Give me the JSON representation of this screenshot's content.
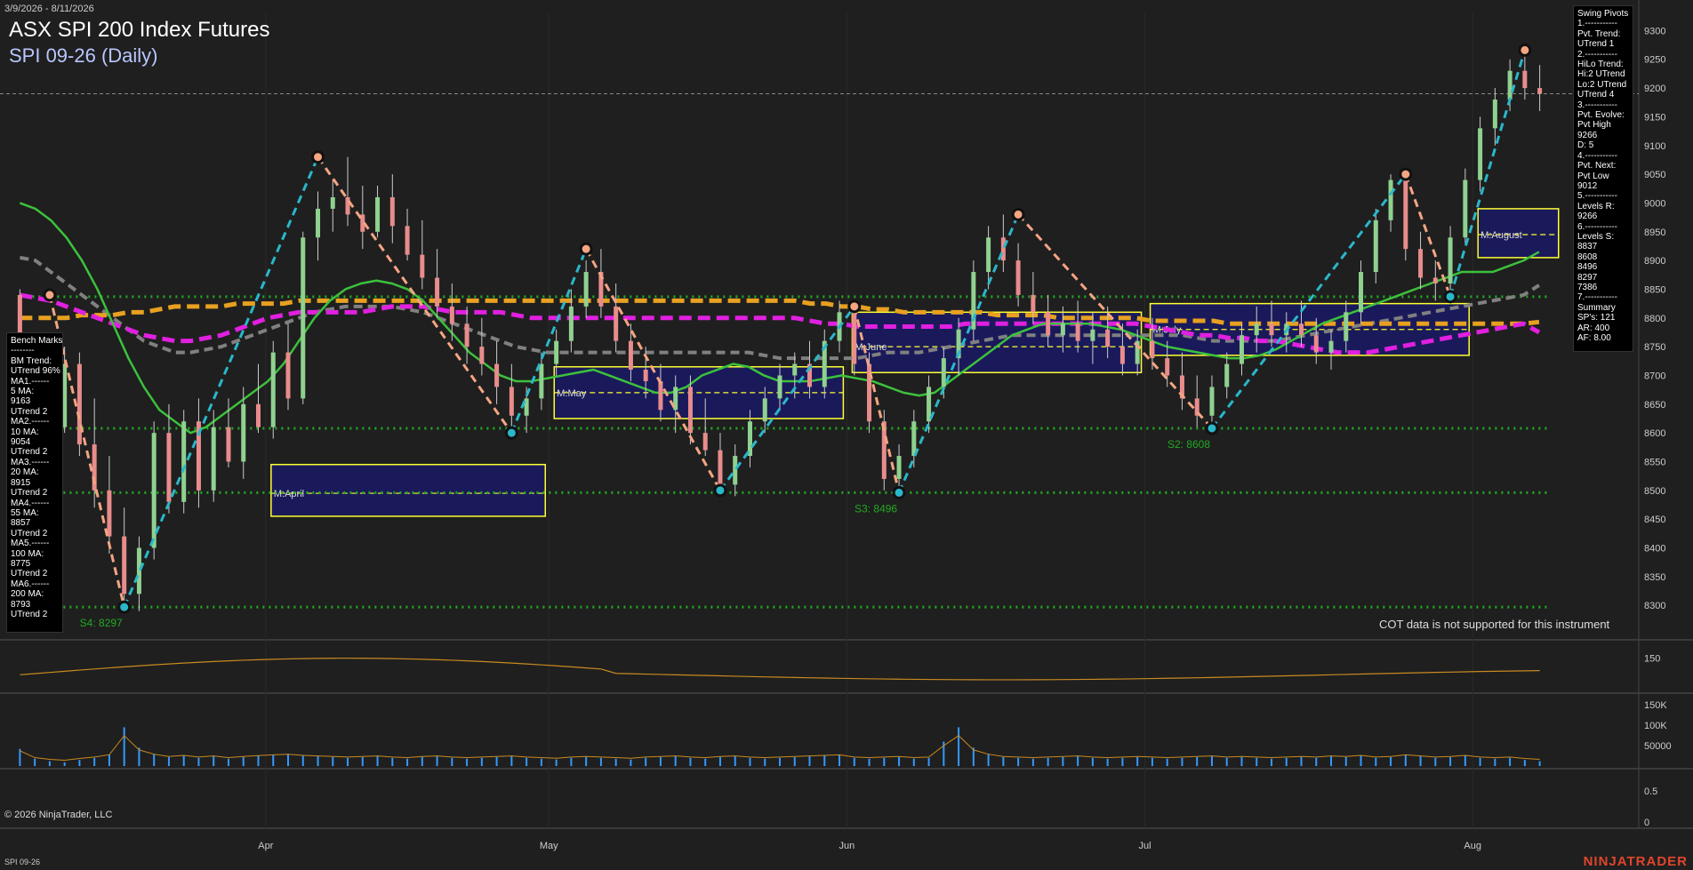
{
  "header": {
    "date_range": "3/9/2026 - 8/11/2026",
    "title": "ASX SPI 200 Index Futures",
    "subtitle": "SPI 09-26 (Daily)"
  },
  "footer": {
    "copyright": "© 2026 NinjaTrader, LLC",
    "instrument": "SPI 09-26",
    "brand": "NINJATRADER"
  },
  "notice": "COT data is not supported for this instrument",
  "bench_marks": [
    "Bench Marks",
    "--------",
    "BM Trend:",
    "UTrend 96%",
    "MA1.------",
    "5 MA:",
    "9163",
    "UTrend 2",
    "MA2.------",
    "10 MA:",
    "9054",
    "UTrend 2",
    "MA3.------",
    "20 MA:",
    "8915",
    "UTrend 2",
    "MA4.------",
    "55 MA:",
    "8857",
    "UTrend 2",
    "MA5.------",
    "100 MA:",
    "8775",
    "UTrend 2",
    "MA6.------",
    "200 MA:",
    "8793",
    "UTrend 2"
  ],
  "swing_pivots": [
    "Swing Pivots",
    "1.-----------",
    "Pvt. Trend:",
    "UTrend 1",
    "2.-----------",
    "HiLo Trend:",
    "Hi:2 UTrend",
    "Lo:2 UTrend",
    "UTrend 4",
    "3.-----------",
    "Pvt. Evolve:",
    "Pvt High",
    "9266",
    "D: 5",
    "4.-----------",
    "Pvt. Next:",
    "Pvt Low",
    "9012",
    "5.-----------",
    "Levels R:",
    "9266",
    "6.-----------",
    "Levels S:",
    "8837",
    "8608",
    "8496",
    "8297",
    "7386",
    "7.-----------",
    "Summary",
    "SP's: 121",
    "AR: 400",
    "AF: 8.00"
  ],
  "colors": {
    "background": "#1f1f1f",
    "up_candle": "#8fd18f",
    "down_candle": "#e88c8c",
    "pivot_up_line": "#2ab7ca",
    "pivot_down_line": "#f4a582",
    "ma_green": "#3cc13c",
    "ma_orange": "#e8a020",
    "ma_magenta": "#e020e0",
    "ma_gray": "#808080",
    "month_box_fill": "#1a1a66",
    "month_box_border": "#ffff33",
    "support_dots": "#22aa22",
    "volume_bar": "#3399ff"
  },
  "chart_data": {
    "type": "candlestick",
    "title": "ASX SPI 200 Index Futures",
    "subtitle": "SPI 09-26 (Daily)",
    "ylim": [
      8240,
      9330
    ],
    "yticks": [
      8300,
      8350,
      8400,
      8450,
      8500,
      8550,
      8600,
      8650,
      8700,
      8750,
      8800,
      8850,
      8900,
      8950,
      9000,
      9050,
      9100,
      9150,
      9200,
      9250,
      9300
    ],
    "x_month_labels": [
      {
        "label": "Apr",
        "index": 17
      },
      {
        "label": "May",
        "index": 36
      },
      {
        "label": "Jun",
        "index": 56
      },
      {
        "label": "Jul",
        "index": 76
      },
      {
        "label": "Aug",
        "index": 98
      }
    ],
    "ohlc": [
      [
        8840,
        8850,
        8650,
        8690
      ],
      [
        8740,
        8760,
        8620,
        8690
      ],
      [
        8690,
        8720,
        8630,
        8660
      ],
      [
        8610,
        8750,
        8600,
        8720
      ],
      [
        8720,
        8740,
        8560,
        8580
      ],
      [
        8580,
        8660,
        8470,
        8500
      ],
      [
        8500,
        8560,
        8390,
        8420
      ],
      [
        8420,
        8470,
        8300,
        8320
      ],
      [
        8320,
        8420,
        8290,
        8400
      ],
      [
        8400,
        8620,
        8380,
        8600
      ],
      [
        8600,
        8650,
        8460,
        8480
      ],
      [
        8480,
        8640,
        8460,
        8620
      ],
      [
        8620,
        8660,
        8470,
        8500
      ],
      [
        8500,
        8640,
        8480,
        8610
      ],
      [
        8610,
        8660,
        8540,
        8550
      ],
      [
        8550,
        8680,
        8520,
        8650
      ],
      [
        8650,
        8720,
        8600,
        8610
      ],
      [
        8610,
        8760,
        8590,
        8740
      ],
      [
        8740,
        8790,
        8640,
        8660
      ],
      [
        8660,
        8950,
        8650,
        8940
      ],
      [
        8940,
        9020,
        8900,
        8990
      ],
      [
        8990,
        9040,
        8950,
        9010
      ],
      [
        9010,
        9080,
        8960,
        8980
      ],
      [
        8980,
        9030,
        8920,
        8950
      ],
      [
        8950,
        9030,
        8940,
        9010
      ],
      [
        9010,
        9050,
        8930,
        8960
      ],
      [
        8960,
        8990,
        8900,
        8910
      ],
      [
        8910,
        8970,
        8850,
        8870
      ],
      [
        8870,
        8920,
        8800,
        8820
      ],
      [
        8820,
        8860,
        8760,
        8790
      ],
      [
        8790,
        8820,
        8720,
        8750
      ],
      [
        8750,
        8800,
        8700,
        8720
      ],
      [
        8720,
        8760,
        8650,
        8680
      ],
      [
        8680,
        8720,
        8610,
        8630
      ],
      [
        8630,
        8680,
        8600,
        8660
      ],
      [
        8660,
        8740,
        8640,
        8720
      ],
      [
        8720,
        8780,
        8700,
        8760
      ],
      [
        8760,
        8850,
        8740,
        8820
      ],
      [
        8820,
        8900,
        8800,
        8880
      ],
      [
        8880,
        8920,
        8800,
        8820
      ],
      [
        8820,
        8860,
        8740,
        8760
      ],
      [
        8760,
        8790,
        8690,
        8710
      ],
      [
        8710,
        8750,
        8660,
        8690
      ],
      [
        8690,
        8720,
        8620,
        8640
      ],
      [
        8640,
        8700,
        8600,
        8680
      ],
      [
        8680,
        8700,
        8580,
        8600
      ],
      [
        8600,
        8660,
        8560,
        8570
      ],
      [
        8570,
        8600,
        8490,
        8510
      ],
      [
        8510,
        8580,
        8490,
        8560
      ],
      [
        8560,
        8640,
        8540,
        8620
      ],
      [
        8620,
        8680,
        8600,
        8660
      ],
      [
        8660,
        8720,
        8640,
        8700
      ],
      [
        8700,
        8740,
        8660,
        8720
      ],
      [
        8720,
        8760,
        8660,
        8680
      ],
      [
        8680,
        8780,
        8660,
        8760
      ],
      [
        8760,
        8830,
        8740,
        8810
      ],
      [
        8810,
        8830,
        8700,
        8720
      ],
      [
        8720,
        8740,
        8600,
        8620
      ],
      [
        8620,
        8640,
        8500,
        8520
      ],
      [
        8520,
        8580,
        8490,
        8560
      ],
      [
        8560,
        8640,
        8540,
        8620
      ],
      [
        8620,
        8700,
        8600,
        8680
      ],
      [
        8680,
        8750,
        8660,
        8730
      ],
      [
        8730,
        8800,
        8700,
        8780
      ],
      [
        8780,
        8900,
        8760,
        8880
      ],
      [
        8880,
        8960,
        8850,
        8940
      ],
      [
        8940,
        8980,
        8880,
        8900
      ],
      [
        8900,
        8930,
        8820,
        8840
      ],
      [
        8840,
        8880,
        8790,
        8810
      ],
      [
        8810,
        8840,
        8750,
        8770
      ],
      [
        8770,
        8820,
        8740,
        8790
      ],
      [
        8790,
        8830,
        8740,
        8760
      ],
      [
        8760,
        8810,
        8720,
        8780
      ],
      [
        8780,
        8820,
        8730,
        8750
      ],
      [
        8750,
        8790,
        8700,
        8720
      ],
      [
        8720,
        8780,
        8700,
        8760
      ],
      [
        8760,
        8800,
        8710,
        8730
      ],
      [
        8730,
        8760,
        8680,
        8700
      ],
      [
        8700,
        8740,
        8640,
        8660
      ],
      [
        8660,
        8700,
        8610,
        8630
      ],
      [
        8630,
        8700,
        8610,
        8680
      ],
      [
        8680,
        8740,
        8660,
        8720
      ],
      [
        8720,
        8790,
        8700,
        8770
      ],
      [
        8770,
        8820,
        8740,
        8790
      ],
      [
        8790,
        8830,
        8750,
        8770
      ],
      [
        8770,
        8810,
        8740,
        8790
      ],
      [
        8790,
        8830,
        8750,
        8770
      ],
      [
        8770,
        8800,
        8720,
        8740
      ],
      [
        8740,
        8780,
        8710,
        8760
      ],
      [
        8760,
        8830,
        8740,
        8810
      ],
      [
        8810,
        8900,
        8790,
        8880
      ],
      [
        8880,
        8990,
        8860,
        8970
      ],
      [
        8970,
        9050,
        8950,
        9040
      ],
      [
        9040,
        9050,
        8900,
        8920
      ],
      [
        8920,
        8950,
        8850,
        8870
      ],
      [
        8870,
        8900,
        8830,
        8860
      ],
      [
        8860,
        8960,
        8840,
        8940
      ],
      [
        8940,
        9060,
        8930,
        9040
      ],
      [
        9040,
        9150,
        9020,
        9130
      ],
      [
        9130,
        9200,
        9100,
        9180
      ],
      [
        9180,
        9250,
        9160,
        9230
      ],
      [
        9230,
        9266,
        9180,
        9200
      ],
      [
        9200,
        9240,
        9160,
        9190
      ]
    ],
    "swing_pivots": [
      {
        "index": 2,
        "price": 8840,
        "type": "high"
      },
      {
        "index": 7,
        "price": 8297,
        "type": "low",
        "label": "S4: 8297"
      },
      {
        "index": 20,
        "price": 9080,
        "type": "high"
      },
      {
        "index": 33,
        "price": 8600,
        "type": "low"
      },
      {
        "index": 38,
        "price": 8920,
        "type": "high"
      },
      {
        "index": 47,
        "price": 8500,
        "type": "low"
      },
      {
        "index": 56,
        "price": 8820,
        "type": "high"
      },
      {
        "index": 59,
        "price": 8496,
        "type": "low",
        "label": "S3: 8496"
      },
      {
        "index": 67,
        "price": 8980,
        "type": "high"
      },
      {
        "index": 80,
        "price": 8608,
        "type": "low",
        "label": "S2: 8608"
      },
      {
        "index": 93,
        "price": 9050,
        "type": "high"
      },
      {
        "index": 96,
        "price": 8837,
        "type": "low"
      },
      {
        "index": 101,
        "price": 9266,
        "type": "high"
      }
    ],
    "support_levels": [
      {
        "label": "S4: 8297",
        "price": 8297
      },
      {
        "label": "S3: 8496",
        "price": 8496
      },
      {
        "label": "S2: 8608",
        "price": 8608
      },
      {
        "price": 8837
      }
    ],
    "month_boxes": [
      {
        "label": "M:April",
        "high": 8545,
        "low": 8455,
        "mid": 8495
      },
      {
        "label": "M:May",
        "high": 8715,
        "low": 8625,
        "mid": 8670
      },
      {
        "label": "M:June",
        "high": 8810,
        "low": 8705,
        "mid": 8750
      },
      {
        "label": "M:July",
        "high": 8825,
        "low": 8735,
        "mid": 8780
      },
      {
        "label": "M:August",
        "high": 8990,
        "low": 8905,
        "mid": 8945
      }
    ],
    "moving_averages": {
      "green": [
        9000,
        8990,
        8970,
        8940,
        8900,
        8850,
        8790,
        8730,
        8680,
        8640,
        8620,
        8600,
        8610,
        8630,
        8650,
        8670,
        8690,
        8720,
        8760,
        8800,
        8830,
        8850,
        8860,
        8865,
        8860,
        8850,
        8830,
        8800,
        8770,
        8740,
        8720,
        8700,
        8690,
        8690,
        8695,
        8700,
        8705,
        8710,
        8700,
        8690,
        8680,
        8670,
        8670,
        8680,
        8700,
        8710,
        8720,
        8715,
        8700,
        8690,
        8690,
        8690,
        8695,
        8700,
        8695,
        8690,
        8680,
        8670,
        8665,
        8670,
        8690,
        8710,
        8730,
        8750,
        8770,
        8780,
        8790,
        8790,
        8790,
        8790,
        8785,
        8780,
        8770,
        8760,
        8750,
        8745,
        8740,
        8735,
        8730,
        8730,
        8735,
        8745,
        8760,
        8775,
        8790,
        8800,
        8810,
        8820,
        8830,
        8840,
        8850,
        8860,
        8870,
        8880,
        8880,
        8880,
        8890,
        8900,
        8915
      ],
      "orange": [
        8800,
        8800,
        8800,
        8800,
        8805,
        8805,
        8805,
        8810,
        8810,
        8815,
        8820,
        8820,
        8820,
        8820,
        8825,
        8825,
        8825,
        8825,
        8830,
        8830,
        8830,
        8830,
        8830,
        8830,
        8830,
        8830,
        8830,
        8830,
        8830,
        8830,
        8830,
        8830,
        8830,
        8830,
        8830,
        8830,
        8830,
        8830,
        8830,
        8830,
        8830,
        8830,
        8830,
        8830,
        8830,
        8830,
        8830,
        8830,
        8830,
        8830,
        8830,
        8825,
        8825,
        8820,
        8820,
        8815,
        8815,
        8810,
        8810,
        8810,
        8810,
        8810,
        8810,
        8805,
        8805,
        8805,
        8805,
        8800,
        8800,
        8800,
        8800,
        8800,
        8800,
        8795,
        8795,
        8795,
        8795,
        8795,
        8790,
        8790,
        8790,
        8790,
        8790,
        8790,
        8790,
        8790,
        8790,
        8790,
        8790,
        8790,
        8790,
        8790,
        8790,
        8790,
        8790,
        8790,
        8790,
        8790,
        8793
      ],
      "magenta": [
        8840,
        8835,
        8830,
        8820,
        8810,
        8800,
        8790,
        8780,
        8770,
        8765,
        8760,
        8760,
        8765,
        8770,
        8780,
        8790,
        8800,
        8805,
        8810,
        8810,
        8810,
        8810,
        8810,
        8815,
        8820,
        8820,
        8820,
        8815,
        8810,
        8810,
        8810,
        8810,
        8805,
        8800,
        8800,
        8800,
        8800,
        8800,
        8800,
        8800,
        8800,
        8800,
        8800,
        8800,
        8800,
        8800,
        8800,
        8800,
        8800,
        8800,
        8800,
        8795,
        8790,
        8790,
        8785,
        8785,
        8785,
        8785,
        8785,
        8785,
        8785,
        8790,
        8790,
        8790,
        8790,
        8790,
        8790,
        8790,
        8790,
        8790,
        8790,
        8790,
        8790,
        8785,
        8780,
        8775,
        8770,
        8770,
        8765,
        8765,
        8760,
        8760,
        8755,
        8750,
        8745,
        8740,
        8740,
        8740,
        8745,
        8750,
        8755,
        8760,
        8765,
        8770,
        8775,
        8780,
        8785,
        8790,
        8775
      ],
      "gray": [
        8905,
        8900,
        8880,
        8860,
        8840,
        8820,
        8800,
        8780,
        8760,
        8750,
        8740,
        8740,
        8745,
        8750,
        8760,
        8770,
        8780,
        8790,
        8800,
        8810,
        8815,
        8820,
        8820,
        8820,
        8820,
        8815,
        8810,
        8800,
        8790,
        8780,
        8770,
        8760,
        8750,
        8745,
        8740,
        8740,
        8740,
        8740,
        8740,
        8740,
        8740,
        8740,
        8740,
        8740,
        8740,
        8740,
        8740,
        8740,
        8735,
        8730,
        8730,
        8730,
        8730,
        8730,
        8730,
        8735,
        8740,
        8740,
        8740,
        8745,
        8750,
        8755,
        8760,
        8765,
        8770,
        8770,
        8770,
        8770,
        8770,
        8770,
        8770,
        8770,
        8770,
        8770,
        8770,
        8770,
        8765,
        8760,
        8760,
        8760,
        8760,
        8760,
        8765,
        8770,
        8775,
        8780,
        8785,
        8790,
        8795,
        8800,
        8805,
        8810,
        8815,
        8820,
        8825,
        8830,
        8835,
        8840,
        8857
      ]
    },
    "volume": [
      42000,
      18000,
      12000,
      9000,
      15000,
      20000,
      28000,
      95000,
      45000,
      30000,
      22000,
      26000,
      20000,
      24000,
      18000,
      22000,
      25000,
      28000,
      30000,
      26000,
      24000,
      22000,
      20000,
      22000,
      24000,
      20000,
      18000,
      22000,
      24000,
      20000,
      18000,
      20000,
      22000,
      24000,
      20000,
      18000,
      16000,
      20000,
      22000,
      20000,
      18000,
      16000,
      20000,
      22000,
      24000,
      20000,
      18000,
      22000,
      24000,
      20000,
      18000,
      20000,
      22000,
      24000,
      26000,
      28000,
      20000,
      18000,
      20000,
      22000,
      18000,
      20000,
      60000,
      95000,
      45000,
      30000,
      22000,
      20000,
      18000,
      20000,
      22000,
      24000,
      20000,
      18000,
      20000,
      22000,
      20000,
      18000,
      20000,
      22000,
      24000,
      20000,
      22000,
      20000,
      18000,
      20000,
      22000,
      20000,
      24000,
      22000,
      26000,
      20000,
      22000,
      28000,
      24000,
      20000,
      22000,
      26000,
      20000,
      18000,
      20000,
      15000,
      12000
    ],
    "oscillator_ylim": [
      130,
      160
    ],
    "oscillator_ticks": [
      150
    ],
    "volume_ticks": [
      {
        "label": "50000",
        "value": 50000
      },
      {
        "label": "100K",
        "value": 100000
      },
      {
        "label": "150K",
        "value": 150000
      }
    ],
    "lower_ticks": [
      {
        "label": "0.5",
        "value": 0.5
      },
      {
        "label": "0",
        "value": 0
      }
    ]
  }
}
